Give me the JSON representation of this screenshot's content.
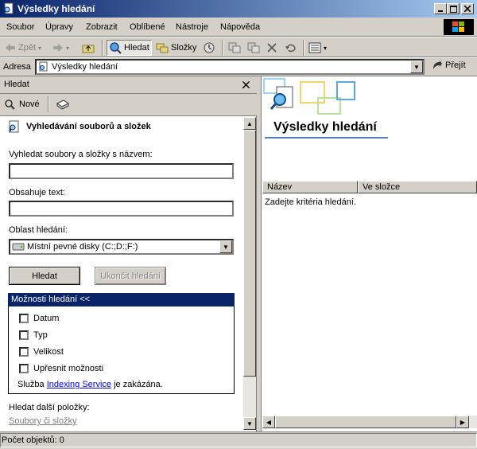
{
  "window": {
    "title": "Výsledky hledání"
  },
  "menu": [
    "Soubor",
    "Úpravy",
    "Zobrazit",
    "Oblíbené",
    "Nástroje",
    "Nápověda"
  ],
  "toolbar": {
    "back": "Zpět",
    "search": "Hledat",
    "folders": "Složky"
  },
  "address": {
    "label": "Adresa",
    "value": "Výsledky hledání",
    "go": "Přejít"
  },
  "search_pane": {
    "header": "Hledat",
    "new_button": "Nové",
    "heading": "Vyhledávání souborů a složek",
    "name_label": "Vyhledat soubory a složky s názvem:",
    "name_value": "",
    "text_label": "Obsahuje text:",
    "text_value": "",
    "scope_label": "Oblast hledání:",
    "scope_value": "Místní pevné disky (C:;D:;F:)",
    "search_button": "Hledat",
    "stop_button": "Ukončit hledání",
    "options_header": "Možnosti hledání <<",
    "options": [
      "Datum",
      "Typ",
      "Velikost",
      "Upřesnit možnosti"
    ],
    "indexing_prefix": "Služba ",
    "indexing_link": "Indexing Service",
    "indexing_suffix": " je zakázána.",
    "other_label": "Hledat další položky:",
    "other_link": "Soubory či složky"
  },
  "results": {
    "title": "Výsledky hledání",
    "columns": [
      "Název",
      "Ve složce"
    ],
    "empty_message": "Zadejte kritéria hledání."
  },
  "status": {
    "text": "Počet objektů: 0"
  }
}
